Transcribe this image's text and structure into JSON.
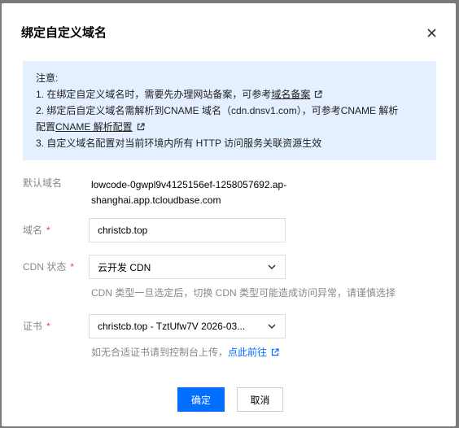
{
  "dialog": {
    "title": "绑定自定义域名"
  },
  "notice": {
    "heading": "注意:",
    "line1_text": "1. 在绑定自定义域名时，需要先办理网站备案，可参考",
    "line1_link": "域名备案",
    "line2_text": "2. 绑定后自定义域名需解析到CNAME 域名（cdn.dnsv1.com），可参考CNAME 解析",
    "line2b_prefix": "配置",
    "line2b_link": "CNAME 解析配置",
    "line3_text": "3. 自定义域名配置对当前环境内所有 HTTP 访问服务关联资源生效"
  },
  "form": {
    "default_domain_label": "默认域名",
    "default_domain_line1": "lowcode-0gwpl9v4125156ef-1258057692.ap-",
    "default_domain_line2": "shanghai.app.tcloudbase.com",
    "domain_label": "域名",
    "domain_value": "christcb.top",
    "cdn_label": "CDN 状态",
    "cdn_value": "云开发 CDN",
    "cdn_hint": "CDN 类型一旦选定后，切换 CDN 类型可能造成访问异常，请谨慎选择",
    "cert_label": "证书",
    "cert_value": "christcb.top - TztUfw7V 2026-03...",
    "cert_hint_text": "如无合适证书请到控制台上传，",
    "cert_hint_link": "点此前往",
    "required_mark": "*"
  },
  "buttons": {
    "confirm": "确定",
    "cancel": "取消"
  },
  "colors": {
    "primary": "#006eff",
    "notice_bg": "#e4efff",
    "required": "#e54545"
  }
}
